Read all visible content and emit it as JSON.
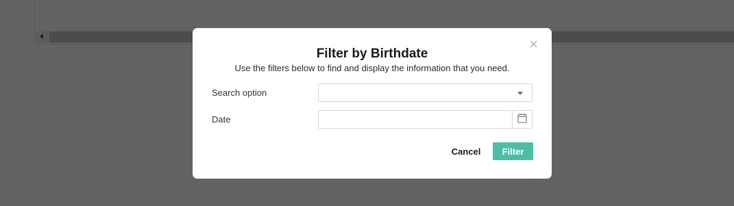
{
  "modal": {
    "title": "Filter by Birthdate",
    "subtitle": "Use the filters below to find and display the information that you need.",
    "close_icon": "close-icon",
    "fields": {
      "search_option": {
        "label": "Search option",
        "value": ""
      },
      "date": {
        "label": "Date",
        "value": "",
        "icon": "calendar-icon"
      }
    },
    "buttons": {
      "cancel_label": "Cancel",
      "filter_label": "Filter"
    }
  },
  "colors": {
    "overlay": "#636363",
    "modal_bg": "#ffffff",
    "accent": "#4dbea6"
  }
}
